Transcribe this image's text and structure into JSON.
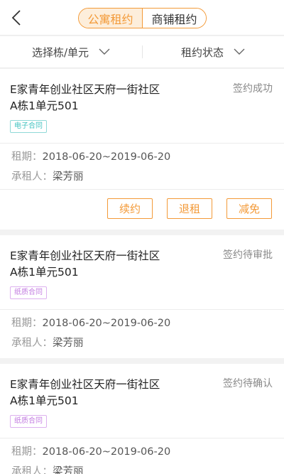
{
  "header": {
    "tabs": [
      {
        "label": "公寓租约",
        "active": true
      },
      {
        "label": "商铺租约",
        "active": false
      }
    ]
  },
  "filters": {
    "building_label": "选择栋/单元",
    "status_label": "租约状态"
  },
  "labels": {
    "period": "租期：",
    "tenant": "承租人："
  },
  "colors": {
    "accent": "#f39a38",
    "electronic_badge": "#43c3c0",
    "paper_badge": "#c27be0"
  },
  "contracts": [
    {
      "address_line1": "E家青年创业社区天府一街社区",
      "address_line2": "A栋1单元501",
      "status": "签约成功",
      "badge": "电子合同",
      "period": "2018-06-20~2019-06-20",
      "tenant": "梁芳丽",
      "actions": [
        "续约",
        "退租",
        "减免"
      ]
    },
    {
      "address_line1": "E家青年创业社区天府一街社区",
      "address_line2": "A栋1单元501",
      "status": "签约待审批",
      "badge": "纸质合同",
      "period": "2018-06-20~2019-06-20",
      "tenant": "梁芳丽"
    },
    {
      "address_line1": "E家青年创业社区天府一街社区",
      "address_line2": "A栋1单元501",
      "status": "签约待确认",
      "badge": "纸质合同",
      "period": "2018-06-20~2019-06-20",
      "tenant": "梁芳丽"
    }
  ]
}
